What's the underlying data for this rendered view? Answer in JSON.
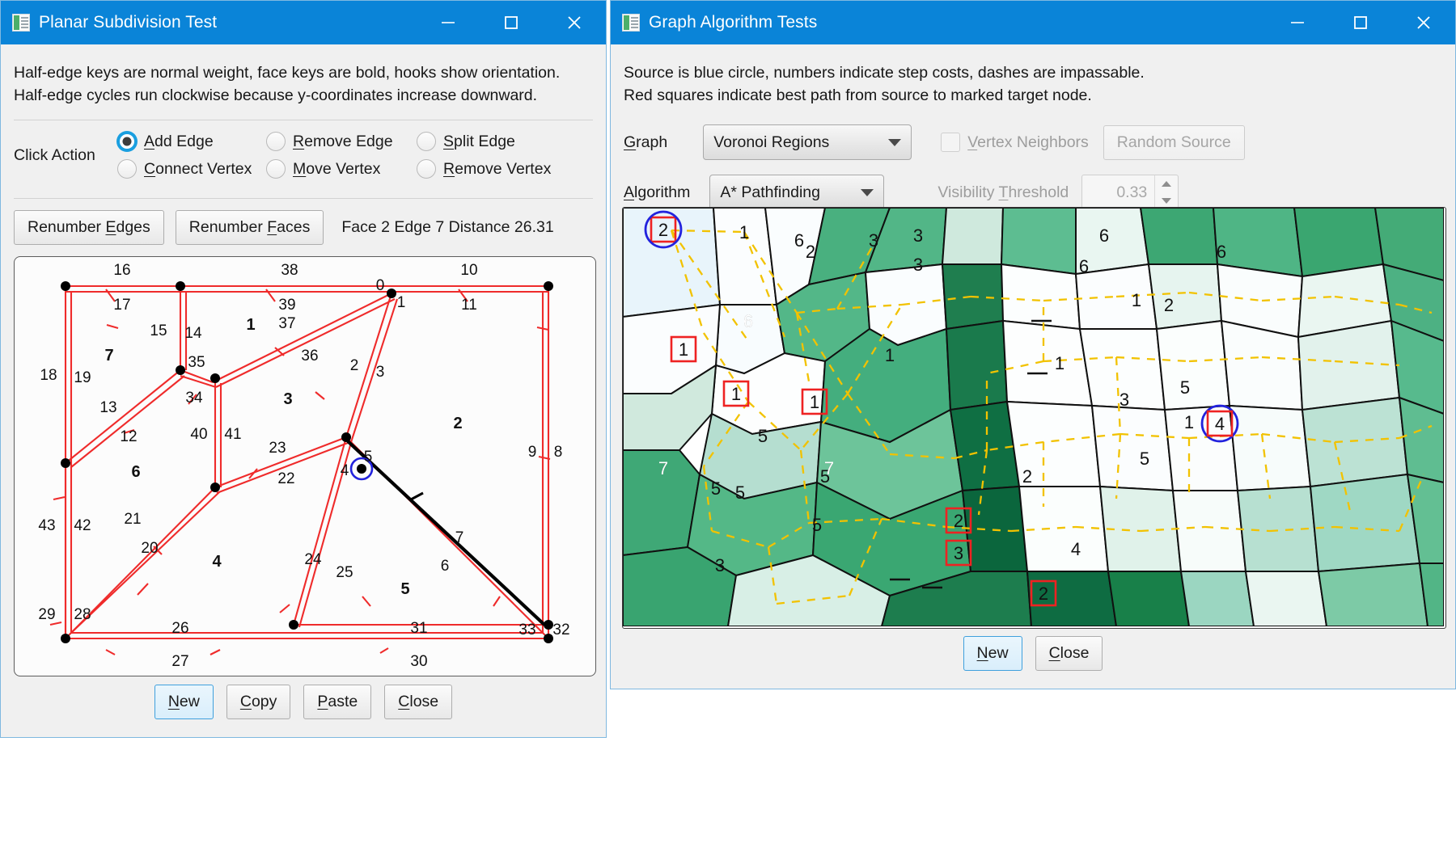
{
  "left_window": {
    "title": "Planar Subdivision Test",
    "icon": "app-icon",
    "window_buttons": [
      "minimize",
      "maximize",
      "close"
    ],
    "description_lines": [
      "Half-edge keys are normal weight, face keys are bold, hooks show orientation.",
      "Half-edge cycles run clockwise because y-coordinates increase downward."
    ],
    "click_action": {
      "label": "Click Action",
      "options": [
        {
          "label": "Add Edge",
          "mnemonic": "A",
          "selected": true
        },
        {
          "label": "Remove Edge",
          "mnemonic": "R",
          "selected": false
        },
        {
          "label": "Split Edge",
          "mnemonic": "S",
          "selected": false
        },
        {
          "label": "Connect Vertex",
          "mnemonic": "C",
          "selected": false
        },
        {
          "label": "Move Vertex",
          "mnemonic": "M",
          "selected": false
        },
        {
          "label": "Remove Vertex",
          "mnemonic": "R",
          "selected": false
        }
      ]
    },
    "toolbar": {
      "renumber_edges": "Renumber Edges",
      "renumber_faces": "Renumber Faces",
      "status": "Face  2 Edge  7 Distance  26.31",
      "status_parts": {
        "face_label": "Face",
        "face_value": "2",
        "edge_label": "Edge",
        "edge_value": "7",
        "distance_label": "Distance",
        "distance_value": "26.31"
      }
    },
    "footer_buttons": [
      {
        "label": "New",
        "mnemonic": "N",
        "primary": true
      },
      {
        "label": "Copy",
        "mnemonic": "C",
        "primary": false
      },
      {
        "label": "Paste",
        "mnemonic": "P",
        "primary": false
      },
      {
        "label": "Close",
        "mnemonic": "C",
        "primary": false
      }
    ],
    "subdivision": {
      "edge_labels": [
        "16",
        "38",
        "10",
        "17",
        "39",
        "11",
        "15",
        "14",
        "1",
        "37",
        "36",
        "18",
        "19",
        "7",
        "35",
        "2",
        "3",
        "13",
        "34",
        "12",
        "40",
        "41",
        "23",
        "4",
        "5",
        "2",
        "9",
        "8",
        "22",
        "43",
        "42",
        "21",
        "20",
        "6",
        "24",
        "7",
        "25",
        "4",
        "29",
        "28",
        "26",
        "5",
        "6",
        "31",
        "33",
        "32",
        "27",
        "30",
        "0",
        "1"
      ],
      "face_labels": [
        "1",
        "7",
        "3",
        "2",
        "6",
        "4",
        "5"
      ],
      "selected_vertex": "marked",
      "highlight_edge_color": "#000000",
      "edge_color": "#ef2b2b"
    }
  },
  "right_window": {
    "title": "Graph Algorithm Tests",
    "icon": "app-icon",
    "window_buttons": [
      "minimize",
      "maximize",
      "close"
    ],
    "description_lines": [
      "Source is blue circle, numbers indicate step costs, dashes are impassable.",
      "Red squares indicate best path from source to marked target node."
    ],
    "controls": {
      "graph_label": "Graph",
      "graph_mnemonic": "G",
      "graph_value": "Voronoi Regions",
      "algorithm_label": "Algorithm",
      "algorithm_mnemonic": "A",
      "algorithm_value": "A* Pathfinding",
      "vertex_neighbors_label": "Vertex Neighbors",
      "vertex_neighbors_mnemonic": "V",
      "vertex_neighbors_checked": false,
      "vertex_neighbors_enabled": false,
      "random_source_label": "Random Source",
      "random_source_enabled": false,
      "visibility_threshold_label": "Visibility Threshold",
      "visibility_threshold_mnemonic": "T",
      "visibility_threshold_value": "0.33",
      "visibility_threshold_enabled": false
    },
    "footer_buttons": [
      {
        "label": "New",
        "mnemonic": "N",
        "primary": true
      },
      {
        "label": "Close",
        "mnemonic": "C",
        "primary": false
      }
    ],
    "graph": {
      "source_node": "2",
      "target_node": "4",
      "path_nodes": [
        "1",
        "1",
        "1",
        "2",
        "3",
        "2"
      ],
      "step_cost_labels": [
        "2",
        "1",
        "6",
        "3",
        "3",
        "3",
        "6",
        "6",
        "2",
        "6",
        "1",
        "2",
        "1",
        "5",
        "1",
        "1",
        "1",
        "5",
        "3",
        "5",
        "7",
        "5",
        "2",
        "5",
        "4",
        "5",
        "5",
        "3",
        "2",
        "3",
        "2",
        "5",
        "7",
        "4"
      ],
      "legend": {
        "source": "blue circle",
        "path": "red squares",
        "impassable": "dashes"
      }
    }
  },
  "colors": {
    "titlebar": "#0a84d8",
    "accent": "#1a9fe0",
    "edge_red": "#ef2b2b",
    "path_red": "#ee2222",
    "source_blue": "#2222dd",
    "dash_yellow": "#f2c200",
    "window_bg": "#f0f0f0"
  }
}
